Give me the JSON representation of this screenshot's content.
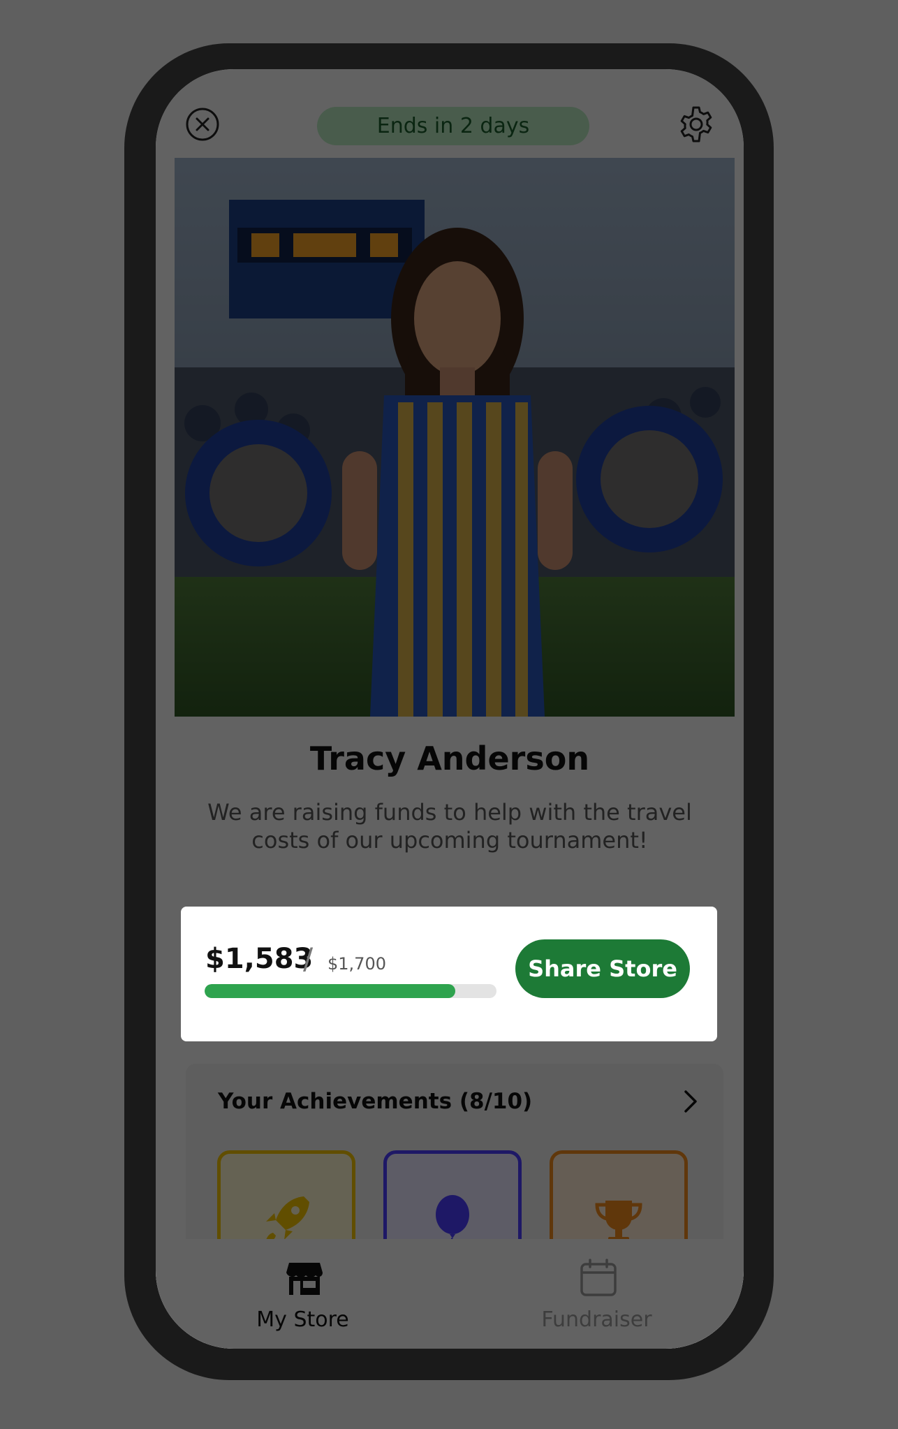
{
  "header": {
    "ends_label": "Ends in 2 days"
  },
  "profile": {
    "name": "Tracy Anderson",
    "description": "We are raising funds to help with the travel costs of our upcoming tournament!"
  },
  "progress": {
    "raised": "$1,583",
    "separator": "/",
    "goal": "$1,700",
    "fraction": 0.86,
    "share_label": "Share Store"
  },
  "achievements": {
    "title": "Your Achievements (8/10)",
    "badges": [
      "rocket-icon",
      "balloon-icon",
      "trophy-icon"
    ]
  },
  "tabs": [
    {
      "label": "My Store",
      "icon": "store-icon",
      "active": true
    },
    {
      "label": "Fundraiser",
      "icon": "calendar-icon",
      "active": false
    }
  ],
  "colors": {
    "accent_green": "#1d7a36",
    "progress_green": "#2ea34e",
    "pill_green": "#b7e7bf",
    "badge_yellow": "#f3c200",
    "badge_purple": "#4b3dff",
    "badge_orange": "#f08a1c"
  }
}
